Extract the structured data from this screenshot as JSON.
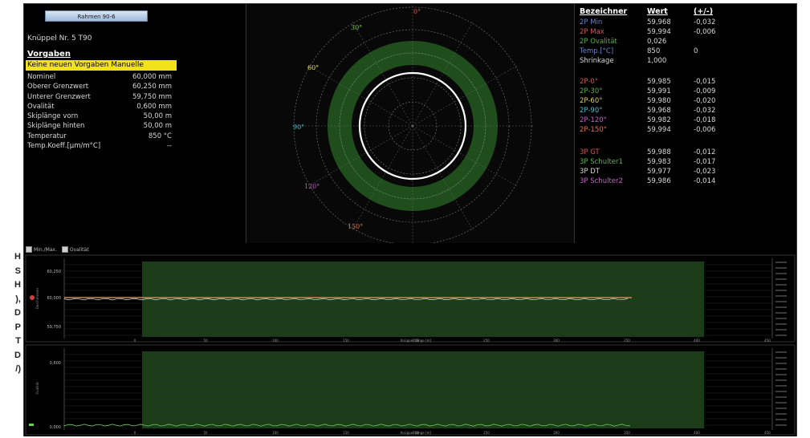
{
  "left_edge_text": [
    "H",
    "S",
    "H",
    "),",
    "D",
    "P",
    "T",
    "D",
    "/)"
  ],
  "info": {
    "rahmen_button": "Rahmen 90-6",
    "knuppel": "Knüppel Nr.  5  T90",
    "vorgaben_title": "Vorgaben",
    "keine_banner": "Keine neuen Vorgaben Manuelle",
    "params": [
      {
        "label": "Nominel",
        "value": "60,000 mm"
      },
      {
        "label": "Oberer Grenzwert",
        "value": "60,250 mm"
      },
      {
        "label": "Unterer Grenzwert",
        "value": "59,750 mm"
      },
      {
        "label": "Ovalität",
        "value": "0,600 mm"
      },
      {
        "label": "Skiplänge vorn",
        "value": "50,00 m"
      },
      {
        "label": "Skiplänge hinten",
        "value": "50,00 m"
      },
      {
        "label": "Temperatur",
        "value": "850 °C"
      },
      {
        "label": "Temp.Koeff.[µm/m°C]",
        "value": "--"
      }
    ]
  },
  "polar": {
    "angle_labels": [
      {
        "text": "0°",
        "color": "#e05050"
      },
      {
        "text": "30°",
        "color": "#7ecf4a"
      },
      {
        "text": "60°",
        "color": "#e6e070"
      },
      {
        "text": "90°",
        "color": "#4ac0d0"
      },
      {
        "text": "120°",
        "color": "#c060c0"
      },
      {
        "text": "150°",
        "color": "#e07050"
      }
    ]
  },
  "table": {
    "headers": {
      "name": "Bezeichner",
      "value": "Wert",
      "delta": "(+/-)"
    },
    "rows": [
      {
        "name": "2P Min",
        "value": "59,968",
        "delta": "-0,032",
        "color": "#6a86c8"
      },
      {
        "name": "2P Max",
        "value": "59,994",
        "delta": "-0,006",
        "color": "#d05a5a"
      },
      {
        "name": "2P Ovalität",
        "value": "0,026",
        "delta": "",
        "color": "#5ab050"
      },
      {
        "name": "Temp.[°C]",
        "value": "850",
        "delta": "0",
        "color": "#6a86c8"
      },
      {
        "name": "Shrinkage",
        "value": "1,000",
        "delta": "",
        "color": "#d9d9d9"
      },
      {
        "name": "2P-0°",
        "value": "59,985",
        "delta": "-0,015",
        "color": "#d05a5a"
      },
      {
        "name": "2P-30°",
        "value": "59,991",
        "delta": "-0,009",
        "color": "#5ab050"
      },
      {
        "name": "2P-60°",
        "value": "59,980",
        "delta": "-0,020",
        "color": "#d8d070"
      },
      {
        "name": "2P-90°",
        "value": "59,968",
        "delta": "-0,032",
        "color": "#4ac0d0"
      },
      {
        "name": "2P-120°",
        "value": "59,982",
        "delta": "-0,018",
        "color": "#c060c0"
      },
      {
        "name": "2P-150°",
        "value": "59,994",
        "delta": "-0,006",
        "color": "#e07050"
      },
      {
        "name": "3P GT",
        "value": "59,988",
        "delta": "-0,012",
        "color": "#d05a5a"
      },
      {
        "name": "3P Schulter1",
        "value": "59,983",
        "delta": "-0,017",
        "color": "#5ab050"
      },
      {
        "name": "3P DT",
        "value": "59,977",
        "delta": "-0,023",
        "color": "#d9d9d9"
      },
      {
        "name": "3P Schulter2",
        "value": "59,986",
        "delta": "-0,014",
        "color": "#c060c0"
      }
    ]
  },
  "charts": {
    "toolbar": [
      "Min./Max.",
      "Ovalität"
    ],
    "chart1_y_ticks": [
      "60,250",
      "60,000",
      "59,750"
    ],
    "chart1_axis_title": "Durchmesser",
    "chart2_y_ticks": [
      "0,600",
      "0,000"
    ],
    "chart2_axis_title": "Ovalität",
    "x_ticks": [
      "0",
      "50",
      "100",
      "150",
      "200",
      "250",
      "300",
      "350",
      "400",
      "450"
    ],
    "x_axis_title": "Knüppel Länge [m]"
  },
  "colors": {
    "band_green": "#1d4a1a",
    "circle": "#ffffff",
    "nominal_line": "#e8a060"
  }
}
